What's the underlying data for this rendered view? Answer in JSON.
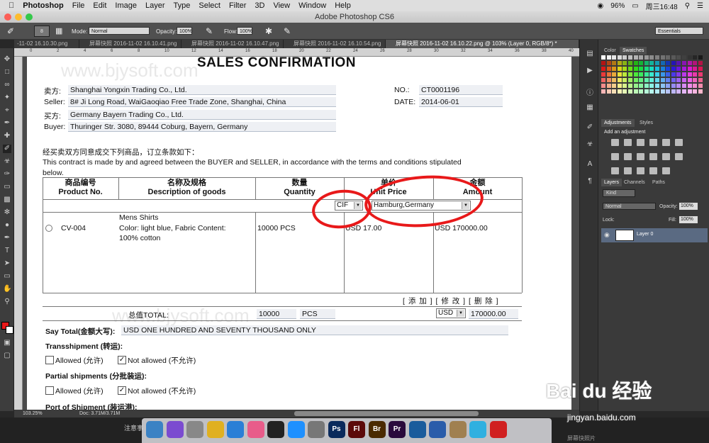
{
  "menubar": {
    "app": "Photoshop",
    "items": [
      "File",
      "Edit",
      "Image",
      "Layer",
      "Type",
      "Select",
      "Filter",
      "3D",
      "View",
      "Window",
      "Help"
    ],
    "battery": "96%",
    "clock": "周三16:48"
  },
  "window_title": "Adobe Photoshop CS6",
  "options": {
    "mode_label": "Mode:",
    "mode_value": "Normal",
    "opacity_label": "Opacity:",
    "opacity_value": "100%",
    "flow_label": "Flow:",
    "flow_value": "100%",
    "brush_size": "8",
    "workspace": "Essentials"
  },
  "tabs": [
    "-11-02 16.10.30.png",
    "屏幕快照 2016-11-02 16.10.41.png",
    "屏幕快照 2016-11-02 16.10.47.png",
    "屏幕快照 2016-11-02 16.10.54.png",
    "屏幕快照 2016-11-02 16.10.22.png @ 103% (Layer 0, RGB/8*) *"
  ],
  "ruler_top": [
    "0",
    "2",
    "4",
    "6",
    "8",
    "10",
    "12",
    "14",
    "16",
    "18",
    "20",
    "22",
    "24",
    "26",
    "28",
    "30",
    "32",
    "34",
    "36",
    "38",
    "40"
  ],
  "doc": {
    "watermark": "www.bjysoft.com",
    "title": "SALES CONFIRMATION",
    "seller_cn": "卖方:",
    "seller_name": "Shanghai Yongxin Trading Co., Ltd.",
    "seller_en": "Seller:",
    "seller_addr": "8# Ji Long Road, WaiGaoqiao Free Trade Zone, Shanghai, China",
    "buyer_cn": "买方:",
    "buyer_name": "Germany Bayern Trading Co., Ltd.",
    "buyer_en": "Buyer:",
    "buyer_addr": "Thuringer Str. 3080, 89444 Coburg, Bayern, Germany",
    "no_label": "NO.:",
    "no_value": "CT0001196",
    "date_label": "DATE:",
    "date_value": "2014-06-01",
    "intro_cn": "经买卖双方同意成交下列商品，订立条款如下：",
    "intro_en": "This contract is made by and agreed between the BUYER and SELLER, in accordance with the terms and conditions stipulated",
    "intro_en2": "below.",
    "col_product_cn": "商品编号",
    "col_product_en": "Product No.",
    "col_desc_cn": "名称及规格",
    "col_desc_en": "Description of goods",
    "col_qty_cn": "数量",
    "col_qty_en": "Quantity",
    "col_price_cn": "单价",
    "col_price_en": "Unit Price",
    "col_amount_cn": "金额",
    "col_amount_en": "Amount",
    "term_select": "CIF",
    "port_select": "Hamburg,Germany",
    "row_product": "CV-004",
    "row_desc1": "Mens Shirts",
    "row_desc2": "Color: light blue, Fabric Content:",
    "row_desc3": "100% cotton",
    "row_qty": "10000 PCS",
    "row_price": "USD 17.00",
    "row_amount": "USD 170000.00",
    "actions": "[ 添 加 ] [ 修 改 ] [ 删 除 ]",
    "total_label": "总值TOTAL:",
    "total_qty": "10000",
    "total_unit": "PCS",
    "total_currency": "USD",
    "total_amount": "170000.00",
    "say_total_label": "Say Total(金额大写):",
    "say_total_value": "USD ONE HUNDRED AND SEVENTY THOUSAND ONLY",
    "transship_label": "Transshipment (转运):",
    "allowed": "Allowed (允许)",
    "not_allowed": "Not allowed (不允许)",
    "partial_label": "Partial shipments (分批装运):",
    "port_label": "Port of Shipment (装运港):"
  },
  "panels": {
    "color_tab": "Color",
    "swatches_tab": "Swatches",
    "adjustments_tab": "Adjustments",
    "styles_tab": "Styles",
    "add_adjustment": "Add an adjustment",
    "layers_tab": "Layers",
    "channels_tab": "Channels",
    "paths_tab": "Paths",
    "kind": "Kind",
    "blend_mode": "Normal",
    "opacity_label": "Opacity:",
    "opacity_value": "100%",
    "lock_label": "Lock:",
    "fill_label": "Fill:",
    "fill_value": "100%",
    "layer_name": "Layer 0"
  },
  "status": {
    "zoom": "103.25%",
    "doc_size": "Doc: 3.71M/3.71M"
  },
  "desktop": {
    "note": "注意事",
    "baidu_text": "Bai du 经验",
    "baidu_url": "jingyan.baidu.com",
    "bottom_right": "屏幕快照片"
  },
  "dock_icons": [
    "Finder",
    "Siri",
    "Launchpad",
    "Chrome",
    "Safari",
    "Photos",
    "QQ",
    "App Store",
    "Settings",
    "Ps",
    "Fl",
    "Br",
    "Pr",
    "QuickTime",
    "Word",
    "Archive",
    "Wunderlist",
    "Flash"
  ],
  "colors": {
    "annotation_red": "#e8191a",
    "panel_bg": "#3a3a3a",
    "field_bg": "#eef0f4"
  }
}
